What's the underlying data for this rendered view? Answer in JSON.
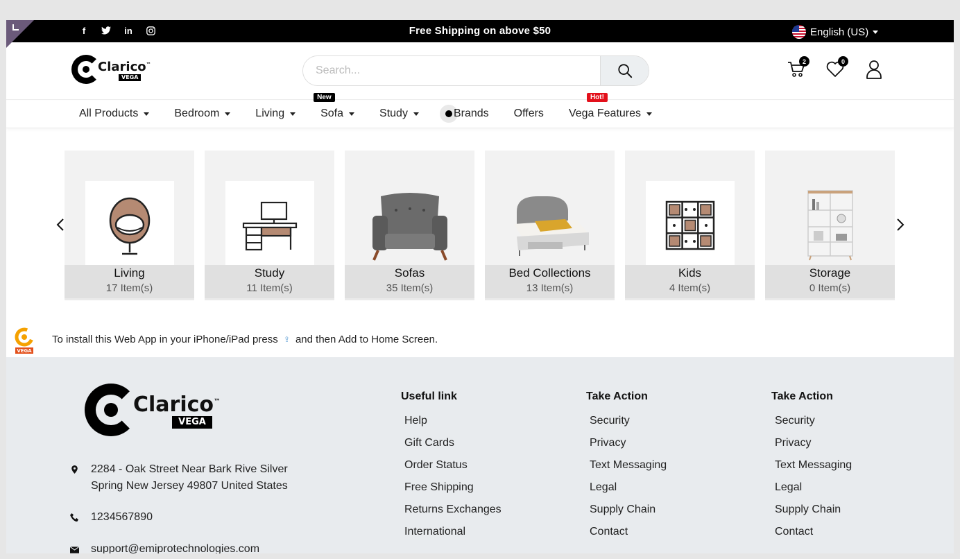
{
  "topbar": {
    "promo": "Free Shipping on above $50",
    "language": "English (US)",
    "social": [
      {
        "icon": "facebook-icon",
        "glyph": "f"
      },
      {
        "icon": "twitter-icon",
        "glyph": "t"
      },
      {
        "icon": "linkedin-icon",
        "glyph": "in"
      },
      {
        "icon": "instagram-icon",
        "glyph": "◎"
      }
    ]
  },
  "header": {
    "brand": "Clarico",
    "brand_tag": "VEGA",
    "search_placeholder": "Search...",
    "cart_count": "2",
    "wishlist_count": "0"
  },
  "nav": {
    "items": [
      {
        "label": "All Products",
        "dropdown": true
      },
      {
        "label": "Bedroom",
        "dropdown": true
      },
      {
        "label": "Living",
        "dropdown": true
      },
      {
        "label": "Sofa",
        "dropdown": true,
        "tag": "New"
      },
      {
        "label": "Study",
        "dropdown": true
      },
      {
        "label": "Brands",
        "dropdown": false
      },
      {
        "label": "Offers",
        "dropdown": false
      },
      {
        "label": "Vega Features",
        "dropdown": true,
        "tag": "Hot!"
      }
    ]
  },
  "categories": [
    {
      "name": "Living",
      "count": "17 Item(s)",
      "icon": "egg-chair-icon"
    },
    {
      "name": "Study",
      "count": "11 Item(s)",
      "icon": "desk-icon"
    },
    {
      "name": "Sofas",
      "count": "35 Item(s)",
      "icon": "armchair-image"
    },
    {
      "name": "Bed Collections",
      "count": "13 Item(s)",
      "icon": "bed-image"
    },
    {
      "name": "Kids",
      "count": "4 Item(s)",
      "icon": "cube-shelf-icon"
    },
    {
      "name": "Storage",
      "count": "0 Item(s)",
      "icon": "bookshelf-image"
    }
  ],
  "install": {
    "text_before": "To install this Web App in your iPhone/iPad press",
    "text_after": "and then Add to Home Screen."
  },
  "footer": {
    "address_line1": "2284 - Oak Street Near Bark Rive Silver",
    "address_line2": "Spring New Jersey 49807 United States",
    "phone": "1234567890",
    "email": "support@emiprotechnologies.com",
    "columns": [
      {
        "title": "Useful link",
        "links": [
          "Help",
          "Gift Cards",
          "Order Status",
          "Free Shipping",
          "Returns Exchanges",
          "International"
        ]
      },
      {
        "title": "Take Action",
        "links": [
          "Security",
          "Privacy",
          "Text Messaging",
          "Legal",
          "Supply Chain",
          "Contact"
        ]
      },
      {
        "title": "Take Action",
        "links": [
          "Security",
          "Privacy",
          "Text Messaging",
          "Legal",
          "Supply Chain",
          "Contact"
        ]
      }
    ]
  },
  "colors": {
    "accent": "#000000",
    "hot": "#e3101b",
    "footer_bg": "#e8ebee"
  }
}
